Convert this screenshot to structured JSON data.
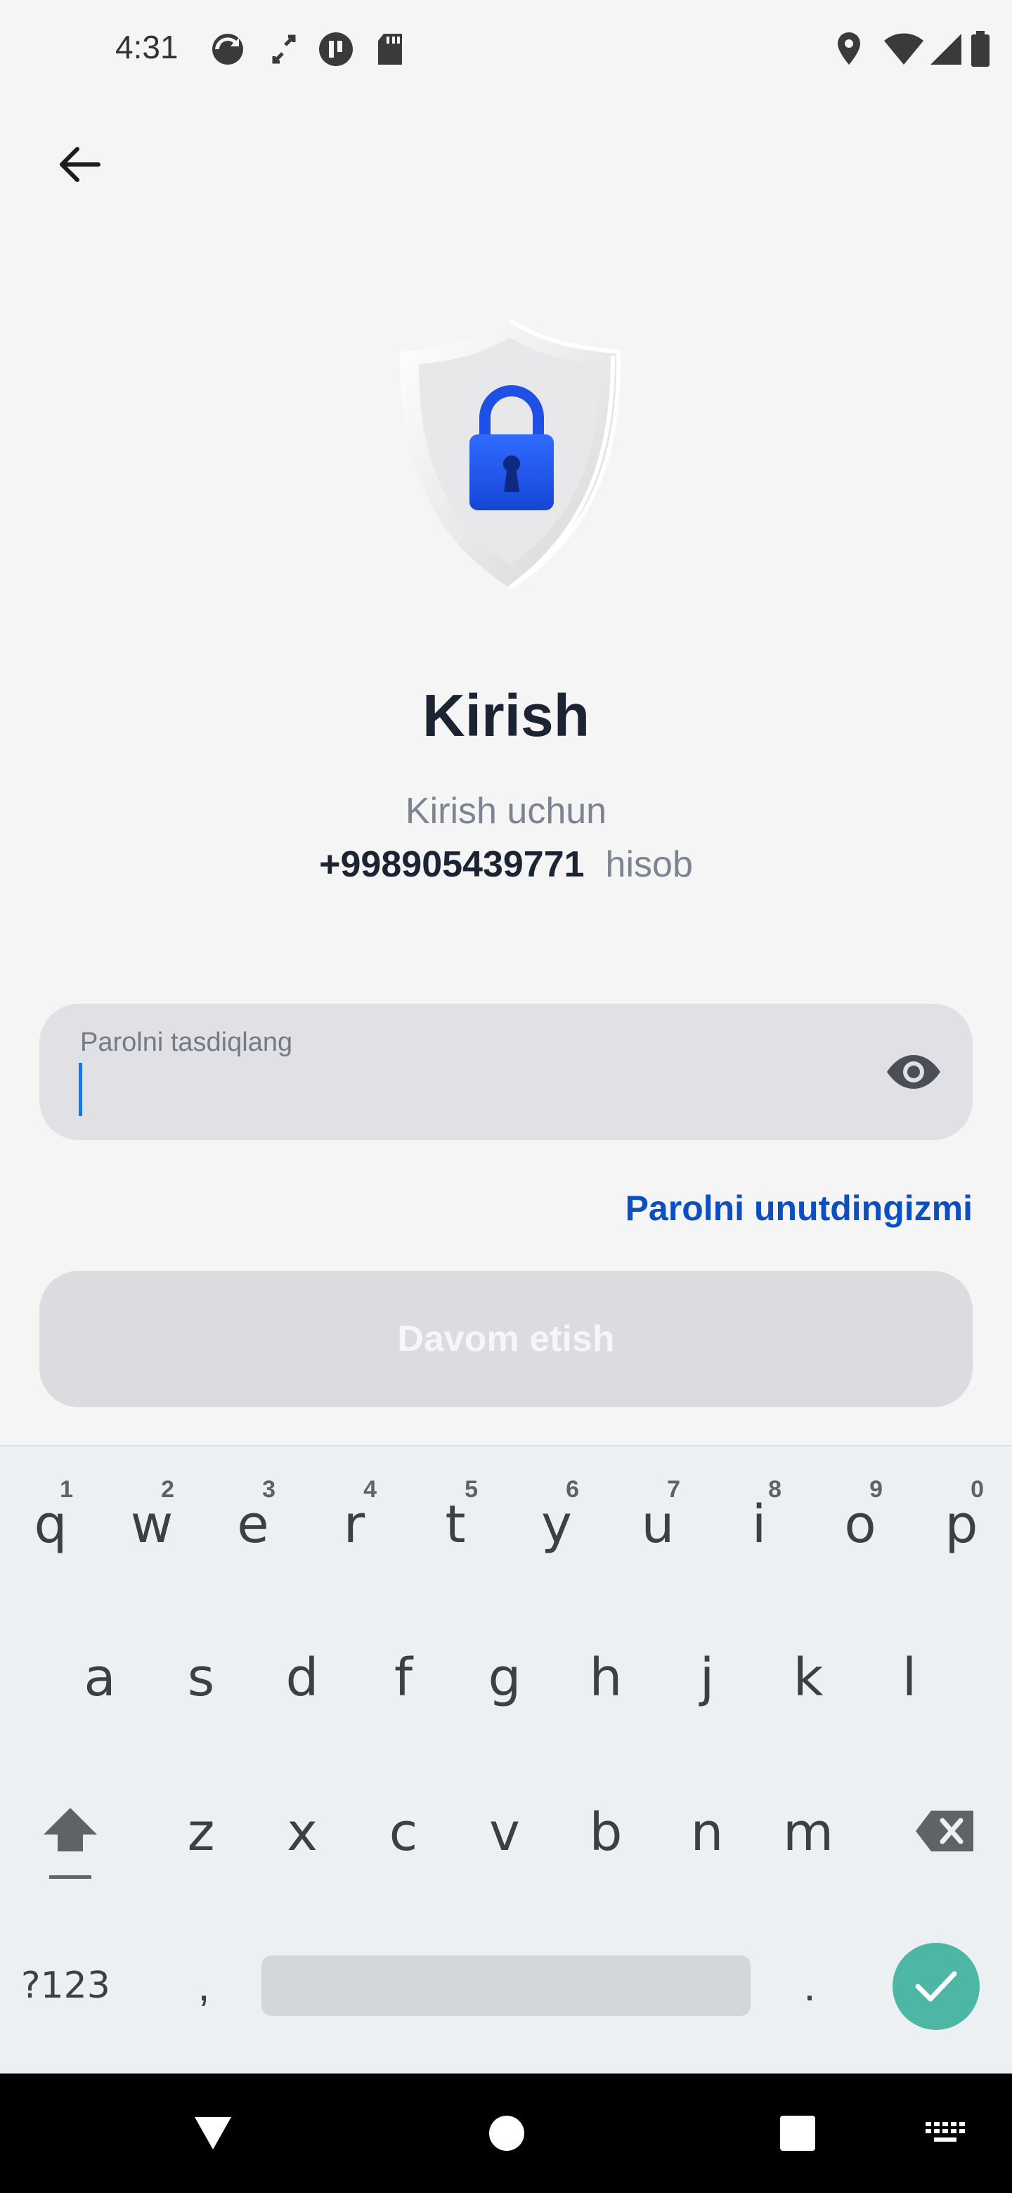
{
  "status_bar": {
    "time": "4:31",
    "left_icons": [
      "sync-icon",
      "arrows-icon",
      "app-icon",
      "sd-card-icon"
    ],
    "right_icons": [
      "location-icon",
      "wifi-icon",
      "signal-icon",
      "battery-icon"
    ]
  },
  "header": {
    "back_icon": "arrow-left-icon"
  },
  "hero": {
    "icon": "shield-lock-icon",
    "accent": "#1a5be8"
  },
  "title": "Kirish",
  "subtitle": "Kirish uchun",
  "phone": {
    "number": "+998905439771",
    "suffix": "hisob"
  },
  "password_field": {
    "label": "Parolni tasdiqlang",
    "value": "",
    "icon": "eye-icon"
  },
  "forgot_link": "Parolni unutdingizmi",
  "continue_button": "Davom etish",
  "keyboard": {
    "row1": [
      {
        "k": "q",
        "h": "1"
      },
      {
        "k": "w",
        "h": "2"
      },
      {
        "k": "e",
        "h": "3"
      },
      {
        "k": "r",
        "h": "4"
      },
      {
        "k": "t",
        "h": "5"
      },
      {
        "k": "y",
        "h": "6"
      },
      {
        "k": "u",
        "h": "7"
      },
      {
        "k": "i",
        "h": "8"
      },
      {
        "k": "o",
        "h": "9"
      },
      {
        "k": "p",
        "h": "0"
      }
    ],
    "row2": [
      "a",
      "s",
      "d",
      "f",
      "g",
      "h",
      "j",
      "k",
      "l"
    ],
    "row3": [
      "z",
      "x",
      "c",
      "v",
      "b",
      "n",
      "m"
    ],
    "symbols": "?123",
    "comma": ",",
    "period": ".",
    "enter_icon": "check-icon",
    "shift_icon": "shift-icon",
    "delete_icon": "backspace-icon",
    "enter_color": "#4db6a5"
  },
  "nav_bar": {
    "icons": [
      "back-triangle-icon",
      "home-circle-icon",
      "recents-square-icon",
      "keyboard-icon"
    ]
  }
}
